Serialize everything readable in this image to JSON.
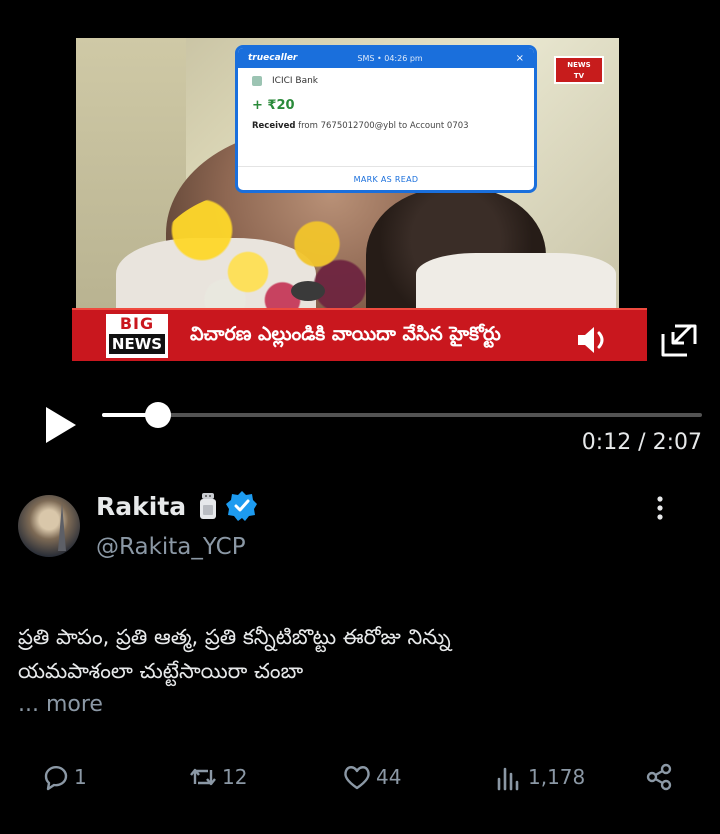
{
  "video": {
    "notification": {
      "app": "truecaller",
      "time": "SMS • 04:26 pm",
      "close": "×",
      "bank": "ICICI Bank",
      "amount": "+ ₹20",
      "body_prefix": "Received",
      "body_rest": "from 7675012700@ybl to Account 0703",
      "action": "MARK AS READ"
    },
    "channel_logo": "NEWS\nTV",
    "ticker": {
      "badge_top": "BIG",
      "badge_bottom": "NEWS",
      "text": "విచారణ ఎల్లుండికి వాయిదా వేసిన హైకోర్టు"
    },
    "progress": {
      "current": "0:12",
      "total": "2:07",
      "label": "0:12 / 2:07",
      "fraction": 0.094
    }
  },
  "author": {
    "name": "Rakita",
    "handle": "@Rakita_YCP",
    "verified_color": "#1d9bf0"
  },
  "post": {
    "line1": "ప్రతి పాపం, ప్రతి ఆత్మ, ప్రతి కన్నీటిబొట్టు ఈరోజు నిన్ను",
    "line2": "యమపాశంలా చుట్టేసాయిరా చంబా",
    "more": "... more"
  },
  "actions": {
    "replies": "1",
    "reposts": "12",
    "likes": "44",
    "views": "1,178"
  },
  "icons": [
    "play-icon",
    "volume-icon",
    "expand-icon",
    "verified-icon",
    "salt-shaker-icon",
    "more-options-icon",
    "reply-icon",
    "repost-icon",
    "like-icon",
    "views-icon",
    "share-icon"
  ]
}
